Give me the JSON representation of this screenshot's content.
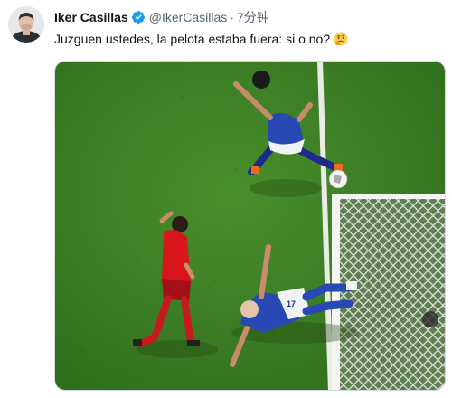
{
  "tweet": {
    "author_name": "Iker Casillas",
    "handle": "@IkerCasillas",
    "separator": "·",
    "time": "7分钟",
    "text": "Juzguen ustedes, la pelota estaba fuera: si o no?",
    "emoji_icon": "thinking-face-emoji",
    "verified_icon": "verified-badge-icon",
    "verified_color": "#1d9bf0"
  },
  "photo": {
    "player_number": "17"
  }
}
